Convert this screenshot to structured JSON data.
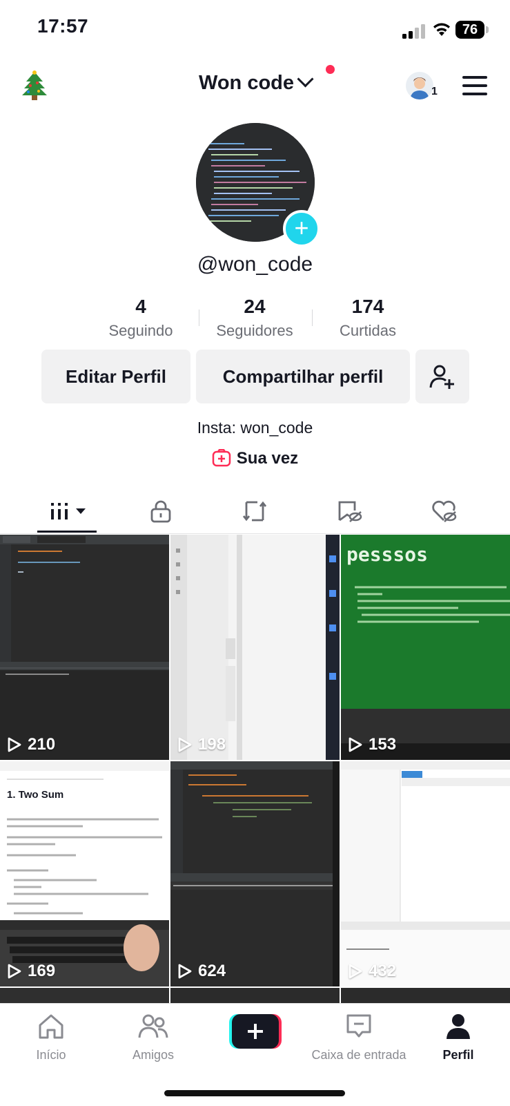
{
  "status_bar": {
    "time": "17:57",
    "battery": "76"
  },
  "header": {
    "title": "Won code",
    "avatar_count": "1"
  },
  "profile": {
    "handle": "@won_code",
    "stats": [
      {
        "value": "4",
        "label": "Seguindo"
      },
      {
        "value": "24",
        "label": "Seguidores"
      },
      {
        "value": "174",
        "label": "Curtidas"
      }
    ],
    "buttons": {
      "edit": "Editar Perfil",
      "share": "Compartilhar perfil"
    },
    "bio": "Insta: won_code",
    "sua_vez": "Sua vez"
  },
  "videos": [
    {
      "views": "210",
      "overlay": ""
    },
    {
      "views": "198",
      "overlay": ""
    },
    {
      "views": "153",
      "overlay": "pesssos"
    },
    {
      "views": "169",
      "overlay": "1. Two Sum"
    },
    {
      "views": "624",
      "overlay": ""
    },
    {
      "views": "432",
      "overlay": ""
    }
  ],
  "nav": {
    "home": "Início",
    "friends": "Amigos",
    "inbox": "Caixa de entrada",
    "profile": "Perfil"
  },
  "colors": {
    "accent": "#fe2c55",
    "cyan": "#20d5ec",
    "text": "#161823"
  }
}
